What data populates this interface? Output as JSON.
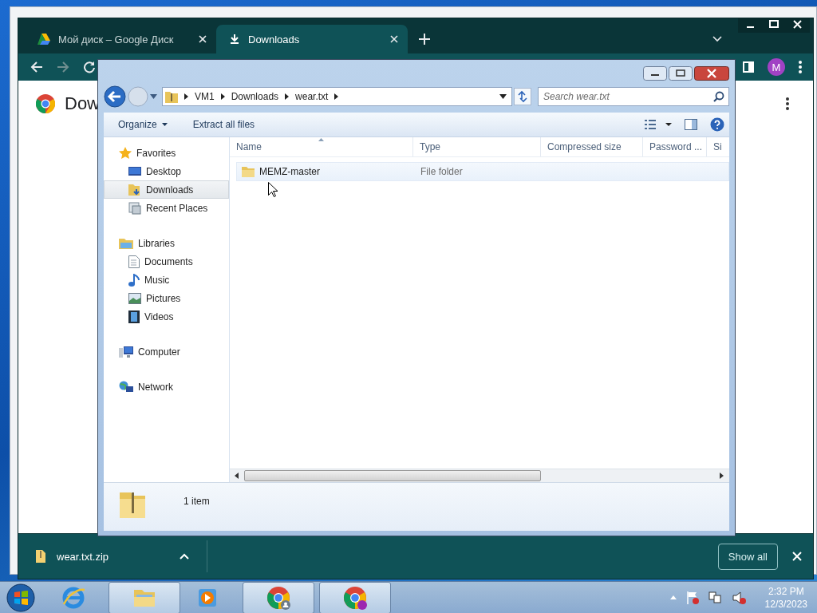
{
  "browser": {
    "tabs": [
      {
        "title": "Мой диск – Google Диск",
        "kind": "drive",
        "selected": false
      },
      {
        "title": "Downloads",
        "kind": "download",
        "selected": true
      }
    ],
    "forward_disabled": true,
    "profile_initial": "M",
    "page_heading": "Dow",
    "download_bar": {
      "file": "wear.txt.zip",
      "button": "Show all"
    }
  },
  "explorer": {
    "breadcrumb": [
      "VM1",
      "Downloads",
      "wear.txt"
    ],
    "search": {
      "placeholder": "Search wear.txt"
    },
    "commands": [
      {
        "label": "Organize",
        "kind": "menu"
      },
      {
        "label": "Extract all files",
        "kind": "plain"
      }
    ],
    "nav": [
      {
        "label": "Favorites",
        "kind": "favorites",
        "selected": false,
        "children": [
          {
            "label": "Desktop",
            "kind": "desktop",
            "selected": false
          },
          {
            "label": "Downloads",
            "kind": "downloads",
            "selected": true
          },
          {
            "label": "Recent Places",
            "kind": "recent",
            "selected": false
          }
        ]
      },
      {
        "label": "Libraries",
        "kind": "libraries",
        "selected": false,
        "children": [
          {
            "label": "Documents",
            "kind": "documents",
            "selected": false
          },
          {
            "label": "Music",
            "kind": "music",
            "selected": false
          },
          {
            "label": "Pictures",
            "kind": "pictures",
            "selected": false
          },
          {
            "label": "Videos",
            "kind": "videos",
            "selected": false
          }
        ]
      },
      {
        "label": "Computer",
        "kind": "computer",
        "selected": false
      },
      {
        "label": "Network",
        "kind": "network",
        "selected": false
      }
    ],
    "columns": [
      {
        "label": "Name",
        "sorted": true
      },
      {
        "label": "Type",
        "sorted": false
      },
      {
        "label": "Compressed size",
        "sorted": false
      },
      {
        "label": "Password ...",
        "sorted": false
      },
      {
        "label": "Si",
        "sorted": false
      }
    ],
    "rows": [
      {
        "name": "MEMZ-master",
        "type": "File folder",
        "hovered": true
      }
    ],
    "status": "1 item"
  },
  "taskbar": {
    "items": [
      {
        "kind": "ie",
        "selected": false
      },
      {
        "kind": "explorer",
        "selected": true
      },
      {
        "kind": "media",
        "selected": false
      },
      {
        "kind": "chrome",
        "selected": true
      },
      {
        "kind": "chrome-m",
        "selected": true
      }
    ],
    "clock": {
      "time": "2:32 PM",
      "date": "12/3/2023"
    }
  }
}
